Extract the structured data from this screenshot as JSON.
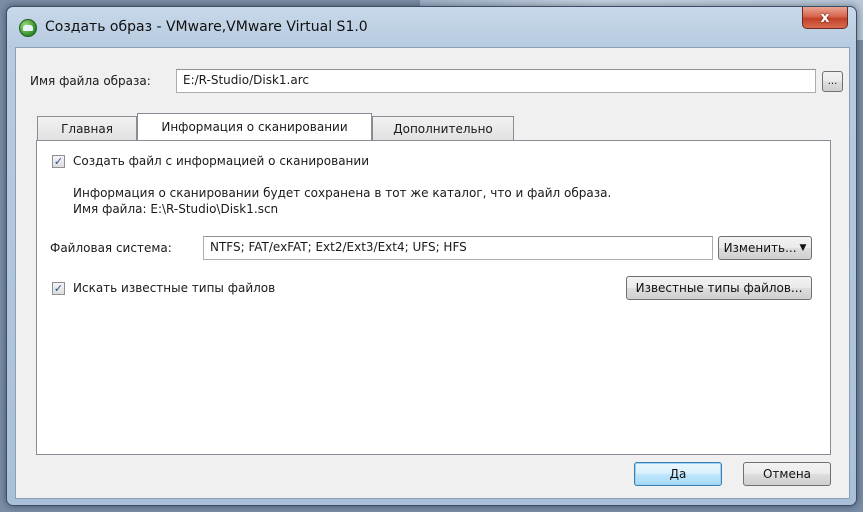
{
  "window": {
    "title": "Создать образ - VMware,VMware Virtual S1.0",
    "close_label": "x"
  },
  "image_file": {
    "label": "Имя файла образа:",
    "value": "E:/R-Studio/Disk1.arc",
    "browse_label": "..."
  },
  "tabs": [
    {
      "label": "Главная",
      "active": false
    },
    {
      "label": "Информация о сканировании",
      "active": true
    },
    {
      "label": "Дополнительно",
      "active": false
    }
  ],
  "scan_info": {
    "create_file_label": "Создать файл с информацией о сканировании",
    "create_file_checked": true,
    "info_line1": "Информация о сканировании будет сохранена в тот же каталог, что и файл образа.",
    "info_line2": "Имя файла: E:\\R-Studio\\Disk1.scn",
    "filesystem_label": "Файловая система:",
    "filesystem_value": "NTFS; FAT/exFAT; Ext2/Ext3/Ext4; UFS; HFS",
    "change_label": "Изменить...",
    "known_types_label": "Искать известные типы файлов",
    "known_types_checked": true,
    "known_types_button": "Известные типы файлов..."
  },
  "footer": {
    "ok_label": "Да",
    "cancel_label": "Отмена"
  }
}
